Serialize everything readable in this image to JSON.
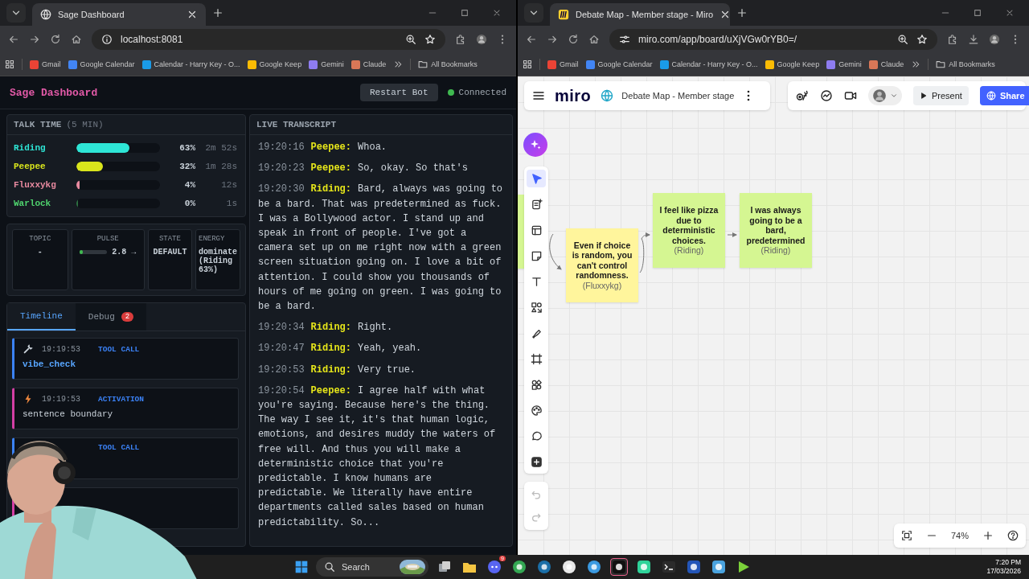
{
  "windows": [
    {
      "tab_title": "Sage Dashboard",
      "url": "localhost:8081",
      "bookmarks": [
        {
          "label": "Gmail",
          "color": "#ea4335"
        },
        {
          "label": "Google Calendar",
          "color": "#4285f4"
        },
        {
          "label": "Calendar - Harry Key - O...",
          "color": "#1a9be8"
        },
        {
          "label": "Google Keep",
          "color": "#fbbc04"
        },
        {
          "label": "Gemini",
          "color": "#8e7cf0"
        },
        {
          "label": "Claude",
          "color": "#d97757"
        }
      ],
      "all_bookmarks": "All Bookmarks"
    },
    {
      "tab_title": "Debate Map - Member stage - Miro",
      "url": "miro.com/app/board/uXjVGw0rYB0=/",
      "bookmarks": [
        {
          "label": "Gmail",
          "color": "#ea4335"
        },
        {
          "label": "Google Calendar",
          "color": "#4285f4"
        },
        {
          "label": "Calendar - Harry Key - O...",
          "color": "#1a9be8"
        },
        {
          "label": "Google Keep",
          "color": "#fbbc04"
        },
        {
          "label": "Gemini",
          "color": "#8e7cf0"
        },
        {
          "label": "Claude",
          "color": "#d97757"
        }
      ],
      "all_bookmarks": "All Bookmarks"
    }
  ],
  "dashboard": {
    "title": "Sage Dashboard",
    "restart_button": "Restart Bot",
    "connection": {
      "label": "Connected",
      "connected": true
    },
    "talk_time": {
      "title": "TALK TIME",
      "window": "(5 MIN)",
      "speakers": [
        {
          "name": "Riding",
          "color": "#2ee6d6",
          "level": 0.63,
          "percent": "63%",
          "duration": "2m 52s"
        },
        {
          "name": "Peepee",
          "color": "#d9e51c",
          "level": 0.32,
          "percent": "32%",
          "duration": "1m 28s"
        },
        {
          "name": "Fluxxykg",
          "color": "#e88aa0",
          "level": 0.04,
          "percent": "4%",
          "duration": "12s"
        },
        {
          "name": "Warlock",
          "color": "#4fd36e",
          "level": 0.0,
          "percent": "0%",
          "duration": "1s"
        }
      ]
    },
    "stats": [
      {
        "kind": "text",
        "label": "TOPIC",
        "value": "-"
      },
      {
        "kind": "meter",
        "label": "PULSE",
        "level": 0.1,
        "value": "2.8 →"
      },
      {
        "kind": "text",
        "label": "STATE",
        "value": "DEFAULT"
      },
      {
        "kind": "text",
        "label": "ENERGY",
        "value": "dominate (Riding 63%)"
      }
    ],
    "tabs": [
      {
        "label": "Timeline",
        "selected": true
      },
      {
        "label": "Debug",
        "selected": false,
        "badge": "2"
      }
    ],
    "timeline": [
      {
        "kind": "tool",
        "time": "19:19:53",
        "label": "TOOL CALL",
        "detail": "vibe_check"
      },
      {
        "kind": "activation",
        "time": "19:19:53",
        "label": "ACTIVATION",
        "detail": "sentence boundary"
      },
      {
        "kind": "tool",
        "label": "TOOL CALL"
      },
      {
        "kind": "activation"
      }
    ],
    "transcript": {
      "title": "LIVE TRANSCRIPT",
      "entries": [
        {
          "time": "19:20:16",
          "speaker": "Peepee:",
          "text": "Whoa."
        },
        {
          "time": "19:20:23",
          "speaker": "Peepee:",
          "text": "So, okay. So that's"
        },
        {
          "time": "19:20:30",
          "speaker": "Riding:",
          "text": "Bard, always was going to be a bard. That was predetermined as fuck. I was a Bollywood actor. I stand up and speak in front of people. I've got a camera set up on me right now with a green screen situation going on. I love a bit of attention. I could show you thousands of hours of me going on green. I was going to be a bard."
        },
        {
          "time": "19:20:34",
          "speaker": "Riding:",
          "text": "Right."
        },
        {
          "time": "19:20:47",
          "speaker": "Riding:",
          "text": "Yeah, yeah."
        },
        {
          "time": "19:20:53",
          "speaker": "Riding:",
          "text": "Very true."
        },
        {
          "time": "19:20:54",
          "speaker": "Peepee:",
          "text": "I agree half with what you're saying. Because here's the thing. The way I see it, it's that human logic, emotions, and desires muddy the waters of free will. And thus you will make a deterministic choice that you're predictable. I know humans are predictable. We literally have entire departments called sales based on human predictability. So..."
        }
      ]
    }
  },
  "miro": {
    "logo": "miro",
    "board_title": "Debate Map - Member stage",
    "present": "Present",
    "share": "Share",
    "tools": [
      {
        "kind": "select",
        "selected": true
      },
      {
        "kind": "note",
        "selected": false
      },
      {
        "kind": "template",
        "selected": false
      },
      {
        "kind": "sticky",
        "selected": false
      },
      {
        "kind": "text",
        "selected": false
      },
      {
        "kind": "shapes",
        "selected": false
      },
      {
        "kind": "pen",
        "selected": false
      },
      {
        "kind": "frame",
        "selected": false
      },
      {
        "kind": "components",
        "selected": false
      },
      {
        "kind": "palette",
        "selected": false
      },
      {
        "kind": "comment",
        "selected": false
      },
      {
        "kind": "add",
        "selected": false
      }
    ],
    "notes": [
      {
        "color": "#d5f692"
      },
      {
        "color": "#fff59c",
        "text": "Even if choice is random, you can't control randomness.",
        "author": "(Fluxxykg)"
      },
      {
        "color": "#d5f692",
        "text": "I feel like pizza due to deterministic choices.",
        "author": "(Riding)"
      },
      {
        "color": "#d5f692",
        "text": "I was always going to be a bard, predetermined",
        "author": "(Riding)"
      }
    ],
    "zoom": "74%"
  },
  "taskbar": {
    "search": "Search",
    "apps": [
      {
        "kind": "taskview",
        "color": "#9aa0a6",
        "selected": false
      },
      {
        "kind": "folder",
        "color": "#f4c542",
        "selected": false
      },
      {
        "kind": "discord",
        "color": "#5865f2",
        "selected": false,
        "badge": "9"
      },
      {
        "kind": "round",
        "color": "#34a853",
        "selected": false
      },
      {
        "kind": "round",
        "color": "#1b6fa8",
        "selected": false
      },
      {
        "kind": "round",
        "color": "#e8e8e8",
        "selected": false
      },
      {
        "kind": "round",
        "color": "#3b9ae1",
        "selected": false
      },
      {
        "kind": "square",
        "color": "#111111",
        "selected": true
      },
      {
        "kind": "square",
        "color": "#2fd39a",
        "selected": false
      },
      {
        "kind": "terminal",
        "color": "#2b2b2b",
        "selected": false
      },
      {
        "kind": "square",
        "color": "#2456b8",
        "selected": false
      },
      {
        "kind": "square",
        "color": "#4aa3df",
        "selected": false
      },
      {
        "kind": "play",
        "color": "#7bd13a",
        "selected": false
      }
    ],
    "time": "7:20 PM",
    "date": "17/03/2026"
  }
}
